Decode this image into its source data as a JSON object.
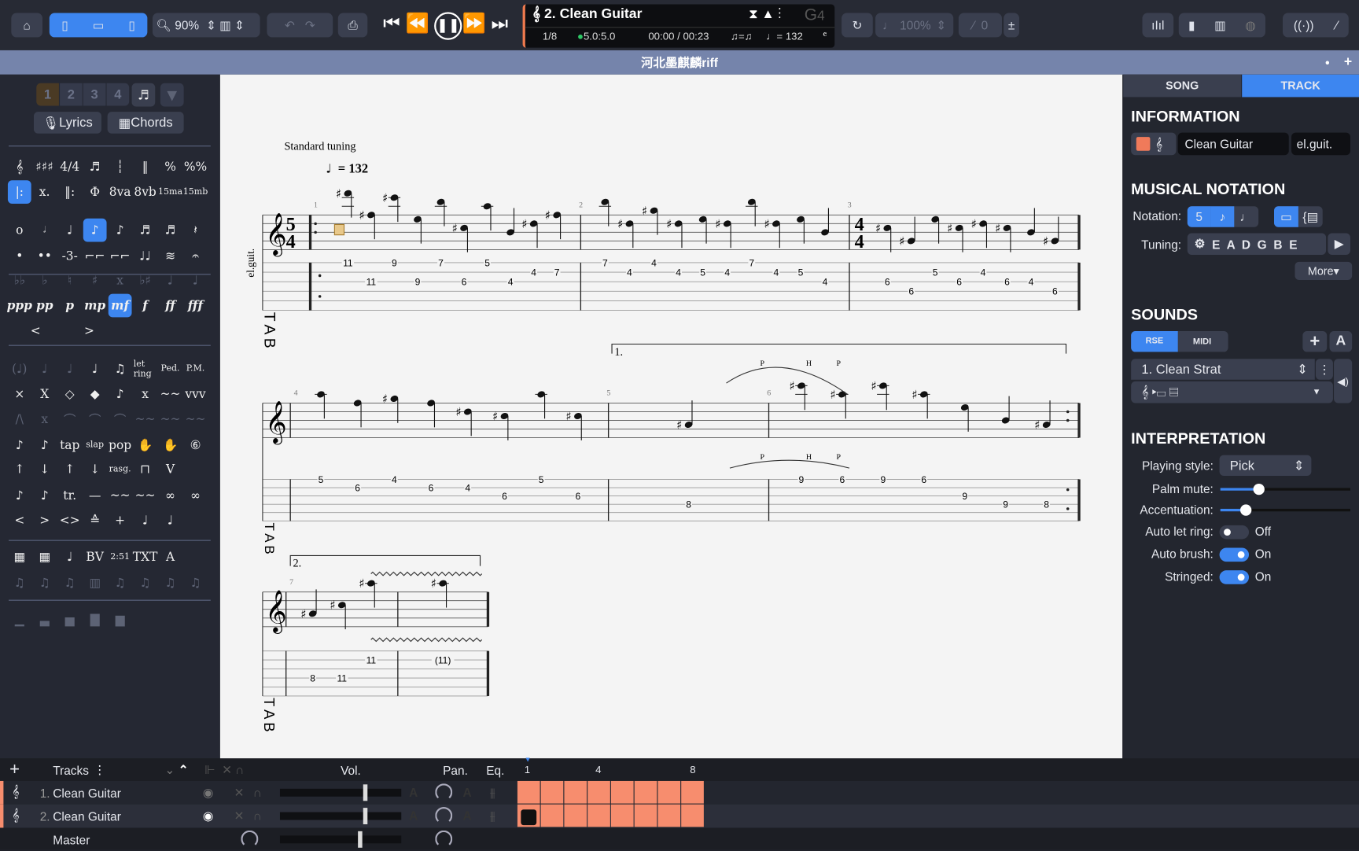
{
  "toolbar": {
    "zoom": "90%",
    "track_title": "2. Clean Guitar",
    "position": "1/8",
    "version": "5.0:5.0",
    "time": "00:00 / 00:23",
    "swing": "♫=♫",
    "tempo": "♩= 132",
    "key": "G",
    "key_sub": "4",
    "speed": "100%",
    "count": "0"
  },
  "file_title": "河北墨麒麟riff",
  "palette": {
    "voices": [
      "1",
      "2",
      "3",
      "4"
    ],
    "lyrics": "Lyrics",
    "chords": "Chords",
    "rows": [
      [
        "𝄞",
        "♯♯♯",
        "4/4",
        "♬",
        "┆",
        "‖",
        "%",
        "%%"
      ],
      [
        "|:",
        "x.",
        "‖:",
        "Φ",
        "8va",
        "8vb",
        "15ma",
        "15mb"
      ],
      [
        "o",
        "𝅗𝅥",
        "♩",
        "♪",
        "♪",
        "♬",
        "♬",
        "𝄽"
      ],
      [
        "•",
        "••",
        "-3-",
        "⌐⌐",
        "⌐⌐",
        "♩♩",
        "≋",
        "𝄐"
      ],
      [
        "♭♭",
        "♭",
        "♮",
        "♯",
        "x",
        "♭♯",
        "♩",
        "♩"
      ],
      [
        "ppp",
        "pp",
        "p",
        "mp",
        "mf",
        "f",
        "ff",
        "fff"
      ],
      [
        "<",
        ">"
      ],
      [
        "(♩)",
        "♩",
        "♩",
        "♩",
        "♫",
        "let ring",
        "Ped.",
        "P.M."
      ],
      [
        "×",
        "X",
        "◇",
        "◆",
        "♪",
        "x",
        "~~",
        "vvv"
      ],
      [
        "/\\",
        "x",
        "⌒",
        "⌒",
        "⌒",
        "~~",
        "~~",
        "~~"
      ],
      [
        "♪",
        "♪",
        "tap",
        "slap",
        "pop",
        "✋",
        "✋",
        "⑥"
      ],
      [
        "↑",
        "↓",
        "↑",
        "↓",
        "rasg.",
        "⊓",
        "V"
      ],
      [
        "♪",
        "♪",
        "tr.",
        "—",
        "~~",
        "~~",
        "∞",
        "∞"
      ],
      [
        "<",
        ">",
        "<>",
        "≙",
        "+",
        "♩",
        "♩"
      ],
      [
        "▦",
        "▦",
        "♩",
        "BV",
        "2:51",
        "TXT",
        "A"
      ],
      [
        "♫",
        "♫",
        "♫",
        "▥",
        "♫",
        "♫",
        "♫",
        "♫"
      ],
      [
        "▁",
        "▃",
        "▅",
        "▇",
        "▆"
      ]
    ]
  },
  "score": {
    "tuning_label": "Standard tuning",
    "tempo": "= 132",
    "instrument": "el.guit.",
    "time_sig_1": [
      "5",
      "4"
    ],
    "time_sig_3": [
      "4",
      "4"
    ],
    "volta_1": "1.",
    "volta_2": "2.",
    "techniques": [
      "P",
      "H",
      "P"
    ],
    "systems": [
      {
        "measures": [
          {
            "num": "1",
            "notes": [
              [
                1,
                "11"
              ],
              [
                3,
                "11"
              ],
              [
                1,
                "9"
              ],
              [
                3,
                "9"
              ],
              [
                1,
                "7"
              ],
              [
                3,
                "6"
              ],
              [
                1,
                "5"
              ],
              [
                3,
                "4"
              ],
              [
                2,
                "4"
              ],
              [
                2,
                "7"
              ]
            ]
          },
          {
            "num": "2",
            "notes": [
              [
                1,
                "7"
              ],
              [
                2,
                "4"
              ],
              [
                1,
                "4"
              ],
              [
                2,
                "4"
              ],
              [
                2,
                "5"
              ],
              [
                2,
                "4"
              ],
              [
                1,
                "7"
              ],
              [
                2,
                "4"
              ],
              [
                2,
                "5"
              ],
              [
                3,
                "4"
              ]
            ]
          },
          {
            "num": "3",
            "notes": [
              [
                3,
                "6"
              ],
              [
                4,
                "6"
              ],
              [
                2,
                "5"
              ],
              [
                3,
                "6"
              ],
              [
                2,
                "4"
              ],
              [
                3,
                "6"
              ],
              [
                3,
                "4"
              ],
              [
                4,
                "6"
              ]
            ]
          }
        ]
      },
      {
        "measures": [
          {
            "num": "4",
            "notes": [
              [
                1,
                "5"
              ],
              [
                2,
                "6"
              ],
              [
                1,
                "4"
              ],
              [
                2,
                "6"
              ],
              [
                2,
                "4"
              ],
              [
                3,
                "6"
              ],
              [
                1,
                "5"
              ],
              [
                3,
                "6"
              ]
            ]
          },
          {
            "num": "5",
            "notes": [
              [
                4,
                "8"
              ]
            ]
          },
          {
            "num": "6",
            "notes": [
              [
                1,
                "9"
              ],
              [
                1,
                "6"
              ],
              [
                1,
                "9"
              ],
              [
                1,
                "6"
              ],
              [
                3,
                "9"
              ],
              [
                4,
                "9"
              ],
              [
                4,
                "8"
              ]
            ]
          }
        ]
      },
      {
        "measures": [
          {
            "num": "7",
            "notes": [
              [
                4,
                "8"
              ],
              [
                4,
                "11"
              ],
              [
                2,
                "11"
              ]
            ]
          },
          {
            "num": "",
            "notes": [
              [
                2,
                "(11)"
              ]
            ]
          }
        ]
      }
    ]
  },
  "panel": {
    "tabs": [
      "SONG",
      "TRACK"
    ],
    "information": "INFORMATION",
    "track_name": "Clean Guitar",
    "short_name": "el.guit.",
    "track_color": "#f07a5a",
    "musical_notation": "MUSICAL NOTATION",
    "notation_label": "Notation:",
    "tuning_label": "Tuning:",
    "tuning": "E A D G B E",
    "more": "More",
    "sounds": "SOUNDS",
    "rse": "RSE",
    "midi": "MIDI",
    "sound_name": "1. Clean Strat",
    "interpretation": "INTERPRETATION",
    "playing_style_label": "Playing style:",
    "playing_style": "Pick",
    "palm_mute_label": "Palm mute:",
    "palm_mute": 0.3,
    "accentuation_label": "Accentuation:",
    "accentuation": 0.2,
    "auto_let_ring_label": "Auto let ring:",
    "auto_let_ring": "Off",
    "auto_brush_label": "Auto brush:",
    "auto_brush": "On",
    "stringed_label": "Stringed:",
    "stringed": "On"
  },
  "tracks": {
    "header": "Tracks",
    "vol": "Vol.",
    "pan": "Pan.",
    "eq": "Eq.",
    "bars": [
      "1",
      "4",
      "8"
    ],
    "rows": [
      {
        "num": "1.",
        "name": "Clean Guitar"
      },
      {
        "num": "2.",
        "name": "Clean Guitar"
      }
    ],
    "master": "Master",
    "accent": "#f78d6e"
  }
}
